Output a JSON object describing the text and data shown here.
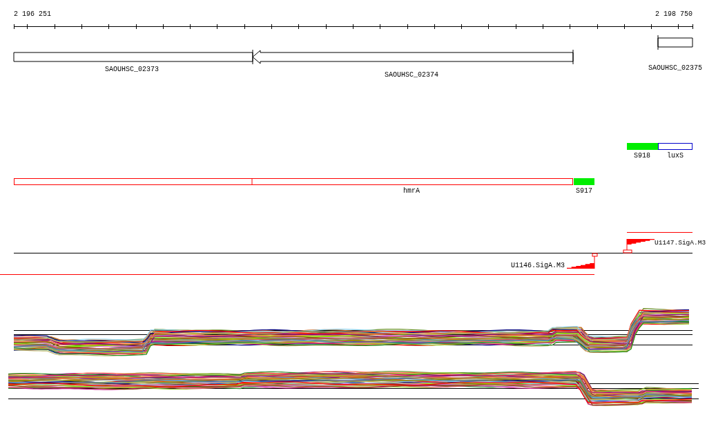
{
  "ruler": {
    "start": "2 196 251",
    "end": "2 198 750"
  },
  "genes": [
    {
      "name": "SAOUHSC_02373"
    },
    {
      "name": "SAOUHSC_02374"
    },
    {
      "name": "SAOUHSC_02375"
    }
  ],
  "features": [
    {
      "name": "S918",
      "kind": "srna",
      "color": "#00ee00"
    },
    {
      "name": "luxS",
      "kind": "gene",
      "color": "#0000cc"
    },
    {
      "name": "hmrA",
      "kind": "gene",
      "color": "#ff0000"
    },
    {
      "name": "S917",
      "kind": "srna",
      "color": "#00ee00"
    }
  ],
  "promoters": [
    {
      "name": "U1147.SigA.M3",
      "kind": "forward"
    },
    {
      "name": "U1146.SigA.M3",
      "kind": "reverse"
    }
  ]
}
